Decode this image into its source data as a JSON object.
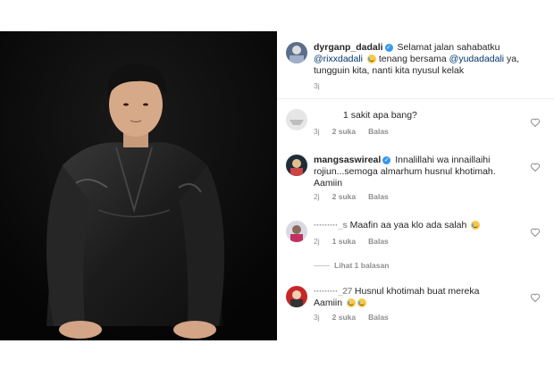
{
  "caption": {
    "username": "dyrganp_dadali",
    "text_1": "Selamat jalan sahabatku",
    "mention_1": "@rixxdadali",
    "text_2": "tenang bersama",
    "mention_2": "@yudadadali",
    "text_3": "ya,",
    "text_4": "tungguin kita, nanti kita nyusul kelak",
    "time": "3j"
  },
  "comments": [
    {
      "username": "",
      "text": "1 sakit apa bang?",
      "time": "3j",
      "likes": "2 suka",
      "reply": "Balas"
    },
    {
      "username": "mangsaswireal",
      "line_1": "Innalillahi wa innaillaihi",
      "line_2": "rojiun...semoga almarhum husnul khotimah.",
      "line_3": "Aamiin",
      "time": "2j",
      "likes": "2 suka",
      "reply": "Balas"
    },
    {
      "username_partial": "·········_s",
      "text": "Maafin aa yaa klo ada salah",
      "time": "2j",
      "likes": "1 suka",
      "reply": "Balas",
      "view_replies": "Lihat 1 balasan"
    },
    {
      "username_partial": "·········_27",
      "line_1": "Husnul khotimah buat mereka",
      "line_2": "Aamiin",
      "time": "3j",
      "likes": "2 suka",
      "reply": "Balas"
    }
  ],
  "colors": {
    "verified": "#3897f0",
    "mention": "#00376b",
    "meta": "#8e8e8e"
  },
  "icons": [
    "heart-outline-icon",
    "verified-badge-icon",
    "emoji-icon"
  ]
}
